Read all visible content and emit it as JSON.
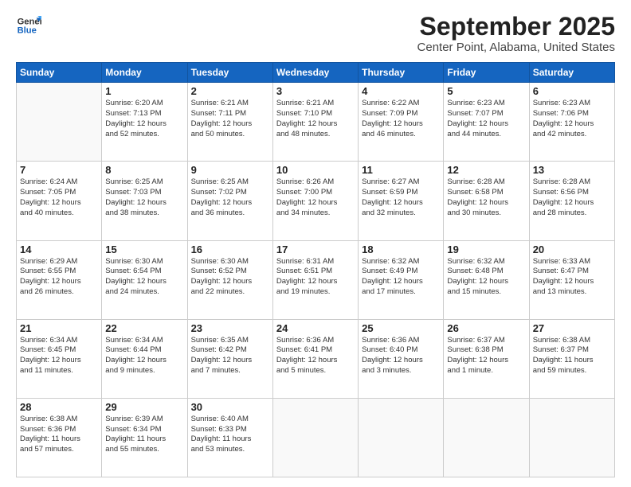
{
  "header": {
    "logo_line1": "General",
    "logo_line2": "Blue",
    "month": "September 2025",
    "location": "Center Point, Alabama, United States"
  },
  "weekdays": [
    "Sunday",
    "Monday",
    "Tuesday",
    "Wednesday",
    "Thursday",
    "Friday",
    "Saturday"
  ],
  "weeks": [
    [
      {
        "day": "",
        "info": ""
      },
      {
        "day": "1",
        "info": "Sunrise: 6:20 AM\nSunset: 7:13 PM\nDaylight: 12 hours\nand 52 minutes."
      },
      {
        "day": "2",
        "info": "Sunrise: 6:21 AM\nSunset: 7:11 PM\nDaylight: 12 hours\nand 50 minutes."
      },
      {
        "day": "3",
        "info": "Sunrise: 6:21 AM\nSunset: 7:10 PM\nDaylight: 12 hours\nand 48 minutes."
      },
      {
        "day": "4",
        "info": "Sunrise: 6:22 AM\nSunset: 7:09 PM\nDaylight: 12 hours\nand 46 minutes."
      },
      {
        "day": "5",
        "info": "Sunrise: 6:23 AM\nSunset: 7:07 PM\nDaylight: 12 hours\nand 44 minutes."
      },
      {
        "day": "6",
        "info": "Sunrise: 6:23 AM\nSunset: 7:06 PM\nDaylight: 12 hours\nand 42 minutes."
      }
    ],
    [
      {
        "day": "7",
        "info": "Sunrise: 6:24 AM\nSunset: 7:05 PM\nDaylight: 12 hours\nand 40 minutes."
      },
      {
        "day": "8",
        "info": "Sunrise: 6:25 AM\nSunset: 7:03 PM\nDaylight: 12 hours\nand 38 minutes."
      },
      {
        "day": "9",
        "info": "Sunrise: 6:25 AM\nSunset: 7:02 PM\nDaylight: 12 hours\nand 36 minutes."
      },
      {
        "day": "10",
        "info": "Sunrise: 6:26 AM\nSunset: 7:00 PM\nDaylight: 12 hours\nand 34 minutes."
      },
      {
        "day": "11",
        "info": "Sunrise: 6:27 AM\nSunset: 6:59 PM\nDaylight: 12 hours\nand 32 minutes."
      },
      {
        "day": "12",
        "info": "Sunrise: 6:28 AM\nSunset: 6:58 PM\nDaylight: 12 hours\nand 30 minutes."
      },
      {
        "day": "13",
        "info": "Sunrise: 6:28 AM\nSunset: 6:56 PM\nDaylight: 12 hours\nand 28 minutes."
      }
    ],
    [
      {
        "day": "14",
        "info": "Sunrise: 6:29 AM\nSunset: 6:55 PM\nDaylight: 12 hours\nand 26 minutes."
      },
      {
        "day": "15",
        "info": "Sunrise: 6:30 AM\nSunset: 6:54 PM\nDaylight: 12 hours\nand 24 minutes."
      },
      {
        "day": "16",
        "info": "Sunrise: 6:30 AM\nSunset: 6:52 PM\nDaylight: 12 hours\nand 22 minutes."
      },
      {
        "day": "17",
        "info": "Sunrise: 6:31 AM\nSunset: 6:51 PM\nDaylight: 12 hours\nand 19 minutes."
      },
      {
        "day": "18",
        "info": "Sunrise: 6:32 AM\nSunset: 6:49 PM\nDaylight: 12 hours\nand 17 minutes."
      },
      {
        "day": "19",
        "info": "Sunrise: 6:32 AM\nSunset: 6:48 PM\nDaylight: 12 hours\nand 15 minutes."
      },
      {
        "day": "20",
        "info": "Sunrise: 6:33 AM\nSunset: 6:47 PM\nDaylight: 12 hours\nand 13 minutes."
      }
    ],
    [
      {
        "day": "21",
        "info": "Sunrise: 6:34 AM\nSunset: 6:45 PM\nDaylight: 12 hours\nand 11 minutes."
      },
      {
        "day": "22",
        "info": "Sunrise: 6:34 AM\nSunset: 6:44 PM\nDaylight: 12 hours\nand 9 minutes."
      },
      {
        "day": "23",
        "info": "Sunrise: 6:35 AM\nSunset: 6:42 PM\nDaylight: 12 hours\nand 7 minutes."
      },
      {
        "day": "24",
        "info": "Sunrise: 6:36 AM\nSunset: 6:41 PM\nDaylight: 12 hours\nand 5 minutes."
      },
      {
        "day": "25",
        "info": "Sunrise: 6:36 AM\nSunset: 6:40 PM\nDaylight: 12 hours\nand 3 minutes."
      },
      {
        "day": "26",
        "info": "Sunrise: 6:37 AM\nSunset: 6:38 PM\nDaylight: 12 hours\nand 1 minute."
      },
      {
        "day": "27",
        "info": "Sunrise: 6:38 AM\nSunset: 6:37 PM\nDaylight: 11 hours\nand 59 minutes."
      }
    ],
    [
      {
        "day": "28",
        "info": "Sunrise: 6:38 AM\nSunset: 6:36 PM\nDaylight: 11 hours\nand 57 minutes."
      },
      {
        "day": "29",
        "info": "Sunrise: 6:39 AM\nSunset: 6:34 PM\nDaylight: 11 hours\nand 55 minutes."
      },
      {
        "day": "30",
        "info": "Sunrise: 6:40 AM\nSunset: 6:33 PM\nDaylight: 11 hours\nand 53 minutes."
      },
      {
        "day": "",
        "info": ""
      },
      {
        "day": "",
        "info": ""
      },
      {
        "day": "",
        "info": ""
      },
      {
        "day": "",
        "info": ""
      }
    ]
  ]
}
